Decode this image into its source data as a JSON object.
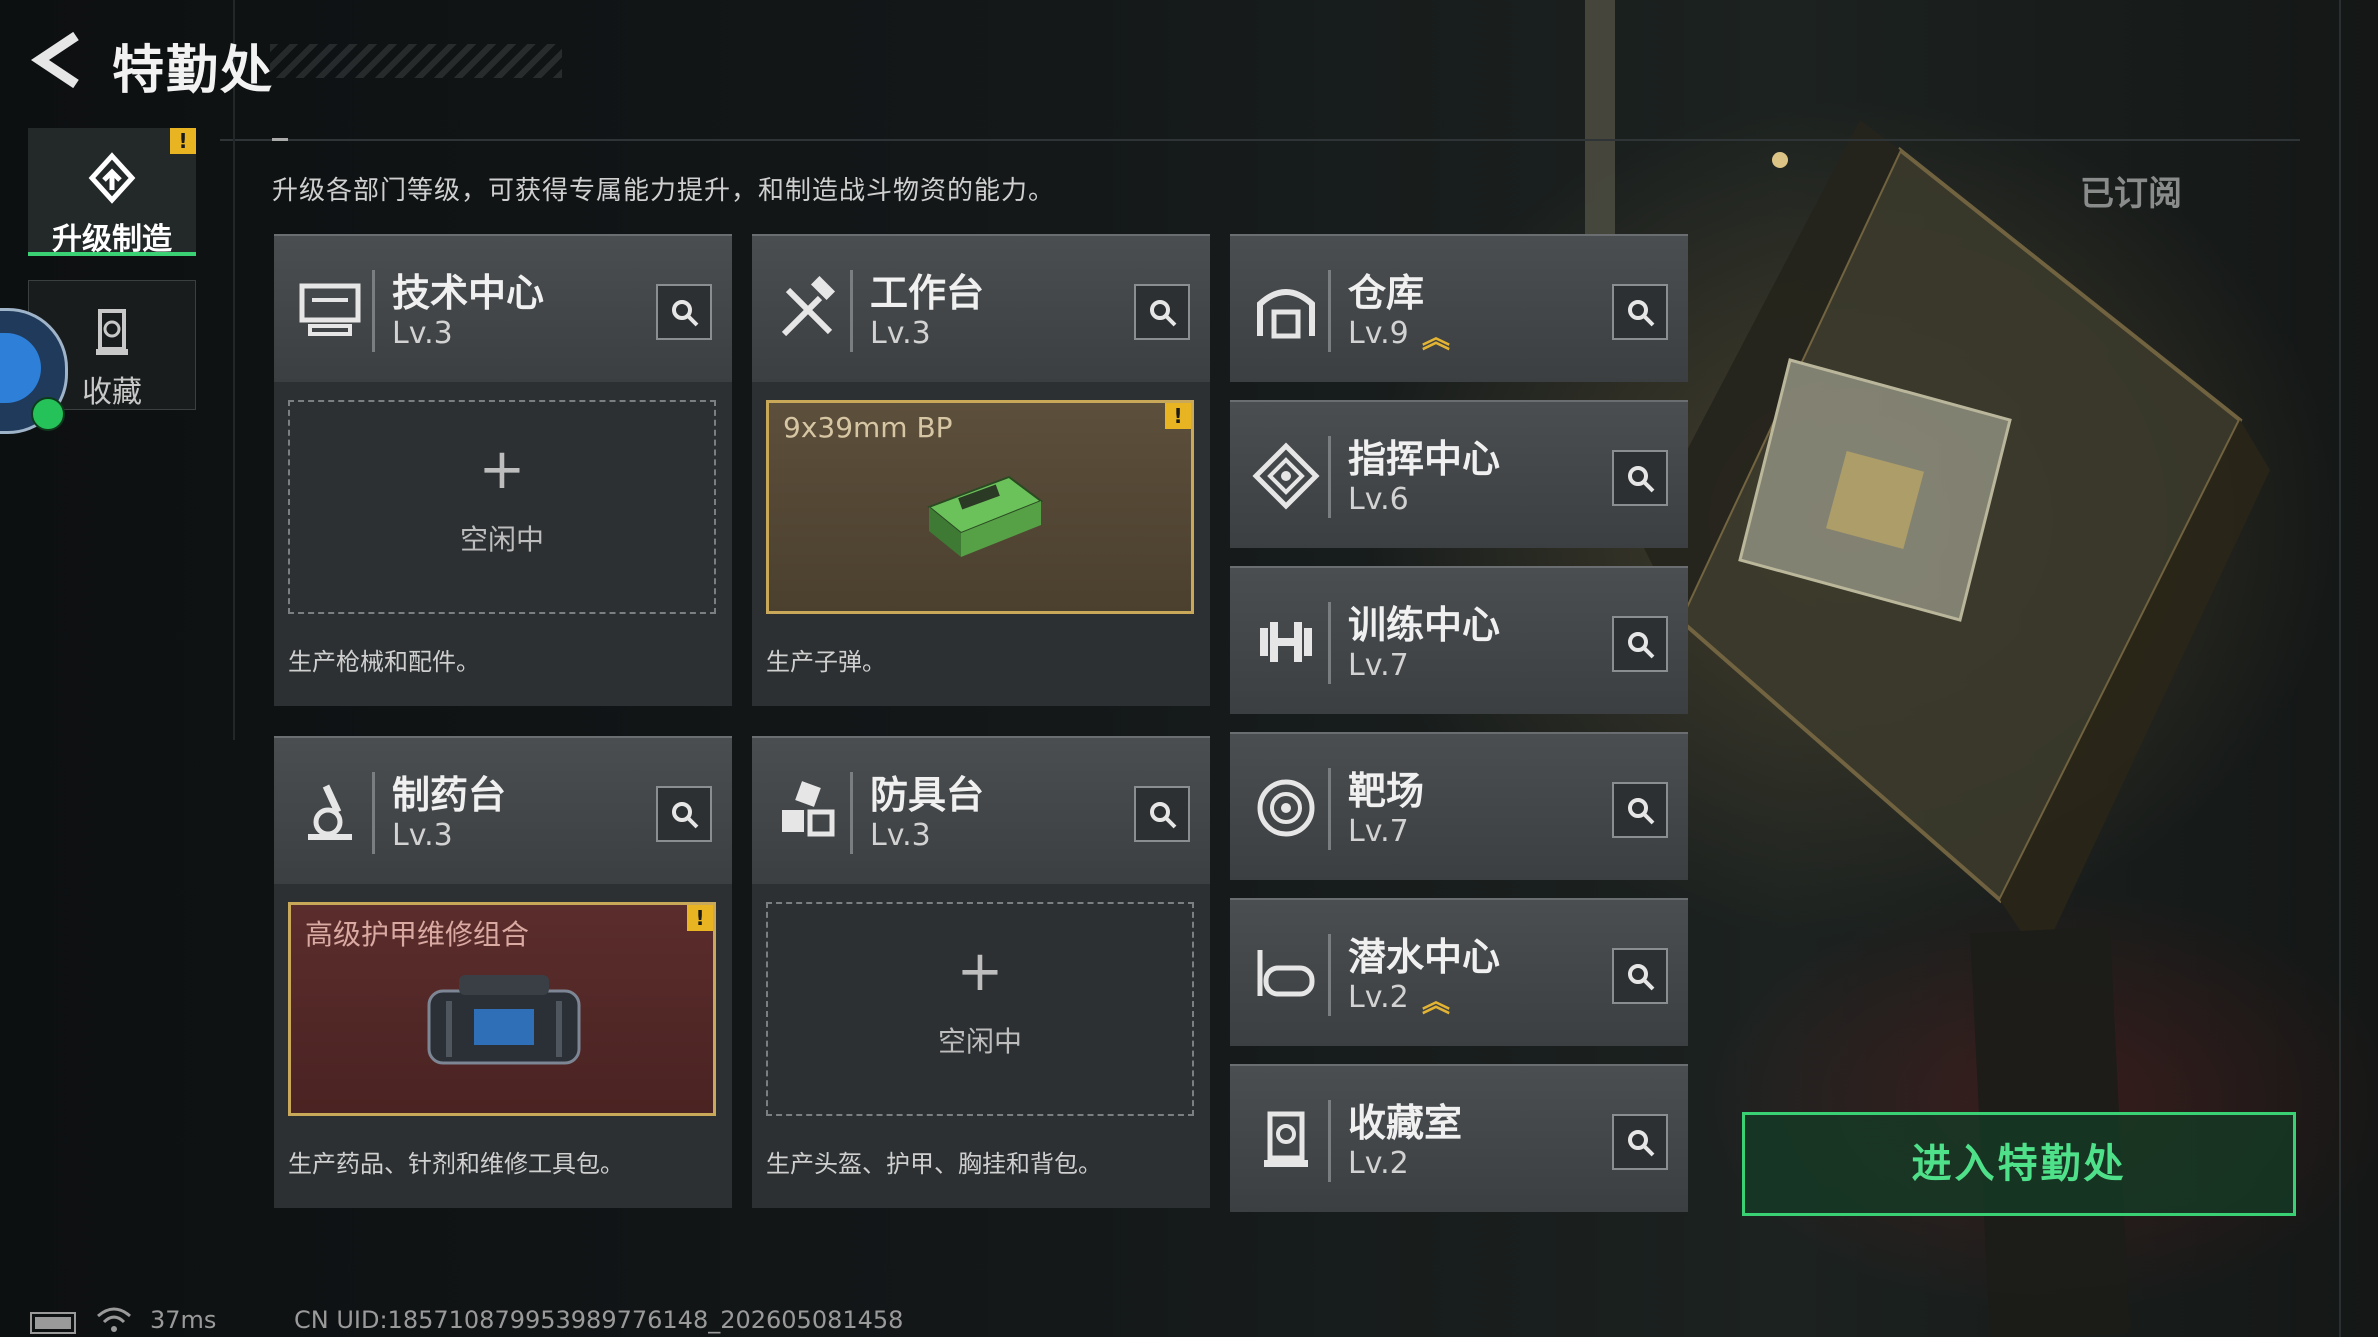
{
  "header": {
    "title": "特勤处"
  },
  "nav": {
    "items": [
      {
        "label": "升级制造",
        "active": true,
        "has_alert": true,
        "icon": "upgrade-icon"
      },
      {
        "label": "收藏",
        "active": false,
        "has_alert": false,
        "icon": "trophy-icon"
      }
    ]
  },
  "description": "升级各部门等级，可获得专属能力提升，和制造战斗物资的能力。",
  "subscribed_label": "已订阅",
  "production_departments": [
    {
      "name": "技术中心",
      "level": "Lv.3",
      "icon": "computer-icon",
      "slot": {
        "state": "idle",
        "plus": "+",
        "label": "空闲中"
      },
      "desc": "生产枪械和配件。"
    },
    {
      "name": "工作台",
      "level": "Lv.3",
      "icon": "tools-icon",
      "slot": {
        "state": "producing",
        "item": "9x39mm BP",
        "alert": true
      },
      "desc": "生产子弹。"
    },
    {
      "name": "制药台",
      "level": "Lv.3",
      "icon": "microscope-icon",
      "slot": {
        "state": "producing",
        "item": "高级护甲维修组合",
        "alert": true
      },
      "desc": "生产药品、针剂和维修工具包。"
    },
    {
      "name": "防具台",
      "level": "Lv.3",
      "icon": "armor-parts-icon",
      "slot": {
        "state": "idle",
        "plus": "+",
        "label": "空闲中"
      },
      "desc": "生产头盔、护甲、胸挂和背包。"
    }
  ],
  "other_departments": [
    {
      "name": "仓库",
      "level": "Lv.9",
      "upgradable": true,
      "icon": "warehouse-icon"
    },
    {
      "name": "指挥中心",
      "level": "Lv.6",
      "upgradable": false,
      "icon": "command-icon"
    },
    {
      "name": "训练中心",
      "level": "Lv.7",
      "upgradable": false,
      "icon": "dumbbell-icon"
    },
    {
      "name": "靶场",
      "level": "Lv.7",
      "upgradable": false,
      "icon": "target-icon"
    },
    {
      "name": "潜水中心",
      "level": "Lv.2",
      "upgradable": true,
      "icon": "diving-mask-icon"
    },
    {
      "name": "收藏室",
      "level": "Lv.2",
      "upgradable": false,
      "icon": "trophy-icon"
    }
  ],
  "enter_button": "进入特勤处",
  "status_bar": {
    "ping": "37ms",
    "uid": "CN UID:1857108799539897761​48_202605081458"
  },
  "colors": {
    "accent_green": "#3ad175",
    "alert_yellow": "#e8b422",
    "upgrade_gold": "#e3b433"
  }
}
